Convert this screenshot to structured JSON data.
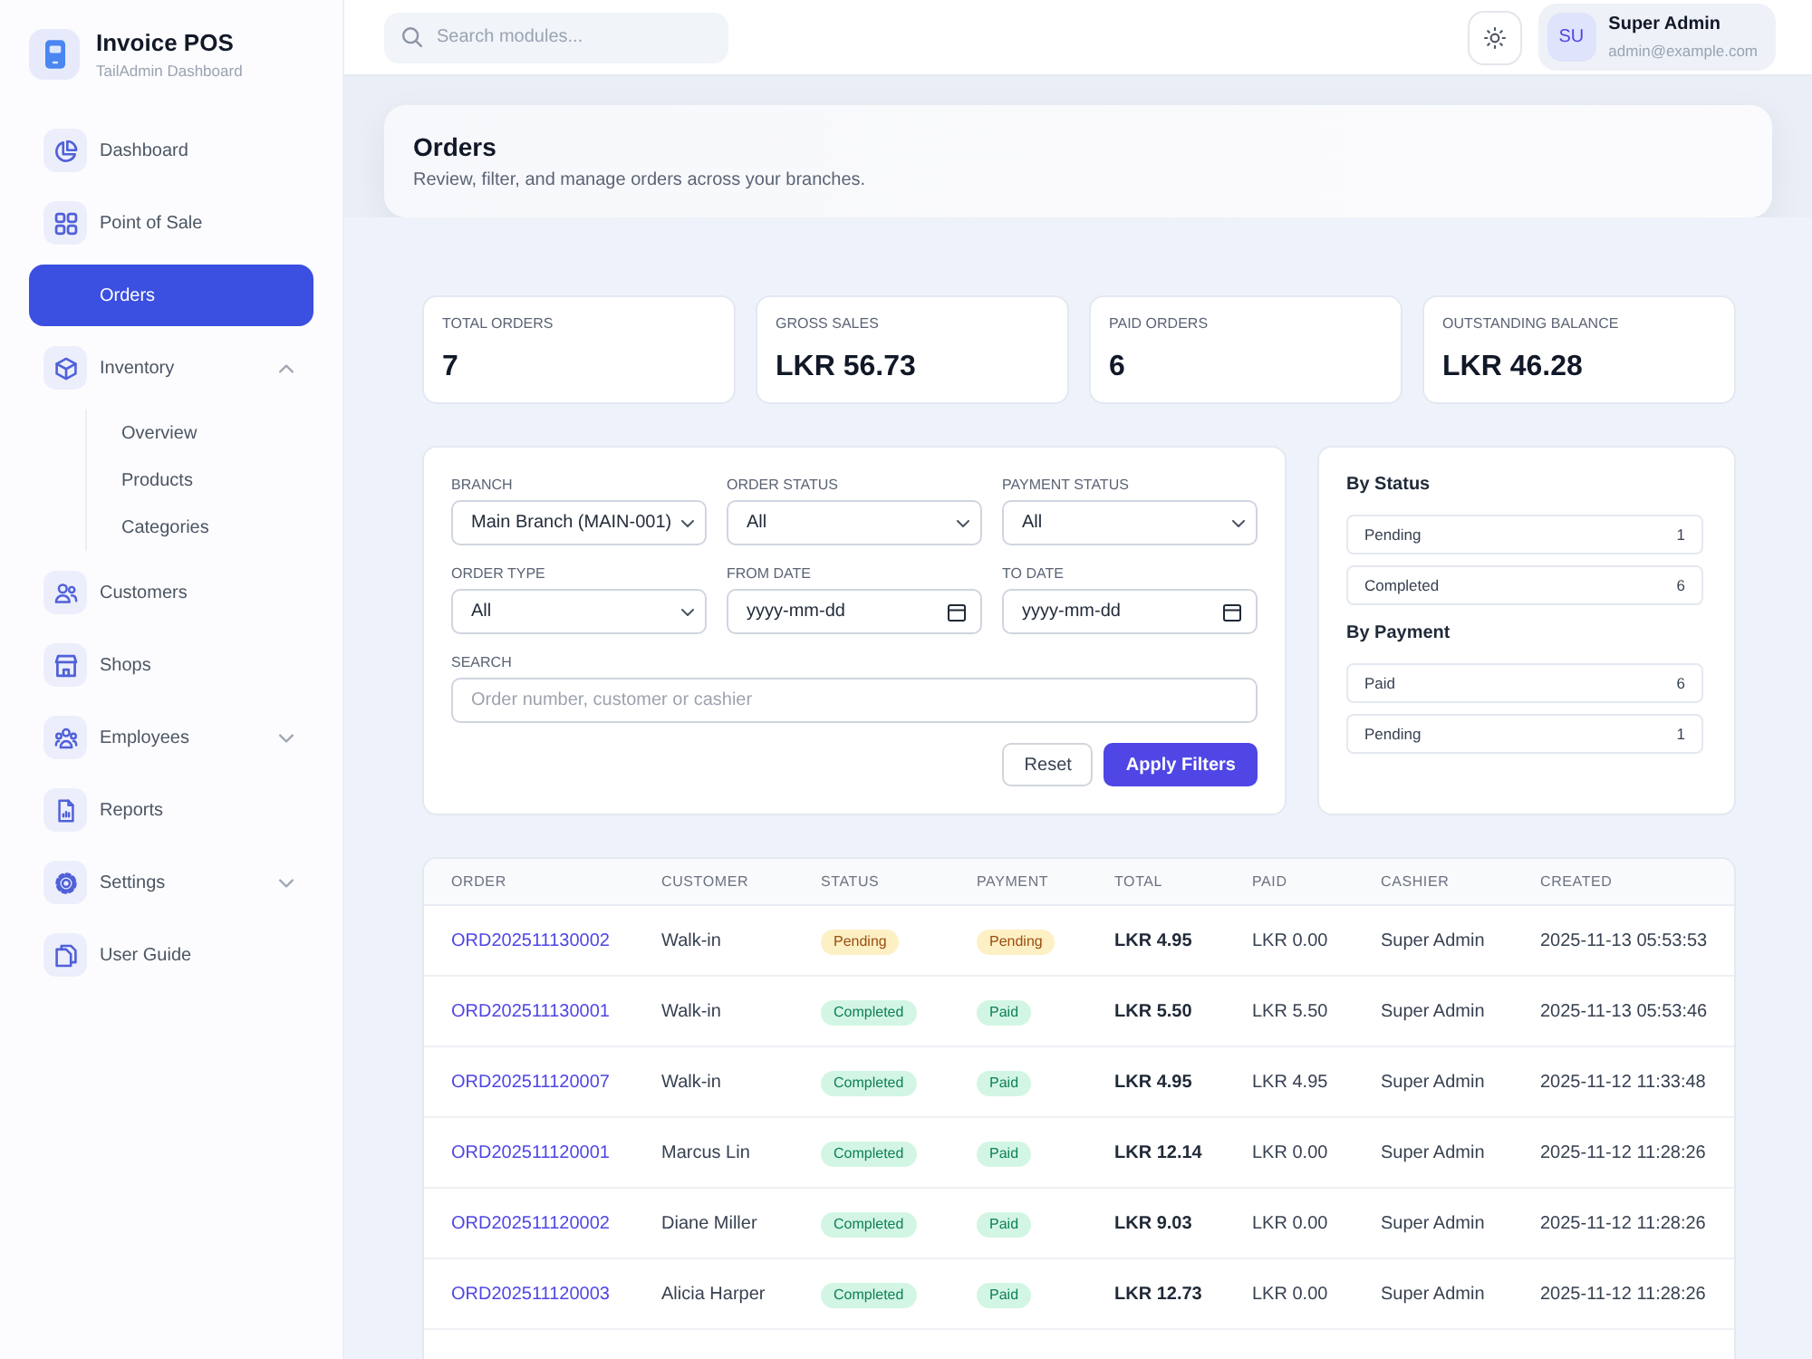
{
  "sidebar": {
    "brand": {
      "title": "Invoice POS",
      "subtitle": "TailAdmin Dashboard"
    },
    "items": [
      {
        "label": "Dashboard",
        "selected": false
      },
      {
        "label": "Point of Sale",
        "selected": false
      },
      {
        "label": "Orders",
        "selected": true
      },
      {
        "label": "Inventory",
        "selected": false,
        "expanded": true,
        "children": [
          {
            "label": "Overview",
            "selected": false
          },
          {
            "label": "Products",
            "selected": false
          },
          {
            "label": "Categories",
            "selected": false
          }
        ]
      },
      {
        "label": "Customers",
        "selected": false
      },
      {
        "label": "Shops",
        "selected": false
      },
      {
        "label": "Employees",
        "selected": false,
        "expanded": false
      },
      {
        "label": "Reports",
        "selected": false
      },
      {
        "label": "Settings",
        "selected": false,
        "expanded": false
      },
      {
        "label": "User Guide",
        "selected": false
      }
    ]
  },
  "topbar": {
    "search": {
      "placeholder": "Search modules..."
    },
    "user": {
      "initials": "SU",
      "name": "Super Admin",
      "email": "admin@example.com"
    }
  },
  "page_header": {
    "title": "Orders",
    "subtitle": "Review, filter, and manage orders across your branches."
  },
  "stats": [
    {
      "label": "TOTAL ORDERS",
      "value": "7"
    },
    {
      "label": "GROSS SALES",
      "value": "LKR 56.73"
    },
    {
      "label": "PAID ORDERS",
      "value": "6"
    },
    {
      "label": "OUTSTANDING BALANCE",
      "value": "LKR 46.28"
    }
  ],
  "filters": {
    "fields": [
      {
        "kind": "select",
        "label": "BRANCH",
        "value": "Main Branch (MAIN-001)"
      },
      {
        "kind": "select",
        "label": "ORDER STATUS",
        "value": "All"
      },
      {
        "kind": "select",
        "label": "PAYMENT STATUS",
        "value": "All"
      },
      {
        "kind": "select",
        "label": "ORDER TYPE",
        "value": "All"
      },
      {
        "kind": "date",
        "label": "FROM DATE",
        "placeholder": "yyyy-mm-dd"
      },
      {
        "kind": "date",
        "label": "TO DATE",
        "placeholder": "yyyy-mm-dd"
      },
      {
        "kind": "text",
        "label": "SEARCH",
        "placeholder": "Order number, customer or cashier"
      }
    ],
    "buttons": [
      {
        "label": "Reset",
        "kind": "reset"
      },
      {
        "label": "Apply Filters",
        "kind": "apply"
      }
    ]
  },
  "summary": {
    "groups": [
      {
        "title": "By Status",
        "rows": [
          {
            "label": "Pending",
            "count": "1"
          },
          {
            "label": "Completed",
            "count": "6"
          }
        ]
      },
      {
        "title": "By Payment",
        "rows": [
          {
            "label": "Paid",
            "count": "6"
          },
          {
            "label": "Pending",
            "count": "1"
          }
        ]
      }
    ]
  },
  "table": {
    "columns": [
      "ORDER",
      "CUSTOMER",
      "STATUS",
      "PAYMENT",
      "TOTAL",
      "PAID",
      "CASHIER",
      "CREATED"
    ],
    "rows": [
      {
        "order": "ORD202511130002",
        "customer": "Walk-in",
        "status": {
          "label": "Pending",
          "color": "#fdf0c4"
        },
        "payment": {
          "label": "Pending",
          "color": "#fdf0c4"
        },
        "total": "LKR 4.95",
        "paid": "LKR 0.00",
        "cashier": "Super Admin",
        "created": "2025-11-13 05:53:53"
      },
      {
        "order": "ORD202511130001",
        "customer": "Walk-in",
        "status": {
          "label": "Completed",
          "color": "#d3f6e4"
        },
        "payment": {
          "label": "Paid",
          "color": "#d3f6e4"
        },
        "total": "LKR 5.50",
        "paid": "LKR 5.50",
        "cashier": "Super Admin",
        "created": "2025-11-13 05:53:46"
      },
      {
        "order": "ORD202511120007",
        "customer": "Walk-in",
        "status": {
          "label": "Completed",
          "color": "#d3f6e4"
        },
        "payment": {
          "label": "Paid",
          "color": "#d3f6e4"
        },
        "total": "LKR 4.95",
        "paid": "LKR 4.95",
        "cashier": "Super Admin",
        "created": "2025-11-12 11:33:48"
      },
      {
        "order": "ORD202511120001",
        "customer": "Marcus Lin",
        "status": {
          "label": "Completed",
          "color": "#d3f6e4"
        },
        "payment": {
          "label": "Paid",
          "color": "#d3f6e4"
        },
        "total": "LKR 12.14",
        "paid": "LKR 0.00",
        "cashier": "Super Admin",
        "created": "2025-11-12 11:28:26"
      },
      {
        "order": "ORD202511120002",
        "customer": "Diane Miller",
        "status": {
          "label": "Completed",
          "color": "#d3f6e4"
        },
        "payment": {
          "label": "Paid",
          "color": "#d3f6e4"
        },
        "total": "LKR 9.03",
        "paid": "LKR 0.00",
        "cashier": "Super Admin",
        "created": "2025-11-12 11:28:26"
      },
      {
        "order": "ORD202511120003",
        "customer": "Alicia Harper",
        "status": {
          "label": "Completed",
          "color": "#d3f6e4"
        },
        "payment": {
          "label": "Paid",
          "color": "#d3f6e4"
        },
        "total": "LKR 12.73",
        "paid": "LKR 0.00",
        "cashier": "Super Admin",
        "created": "2025-11-12 11:28:26"
      }
    ]
  }
}
